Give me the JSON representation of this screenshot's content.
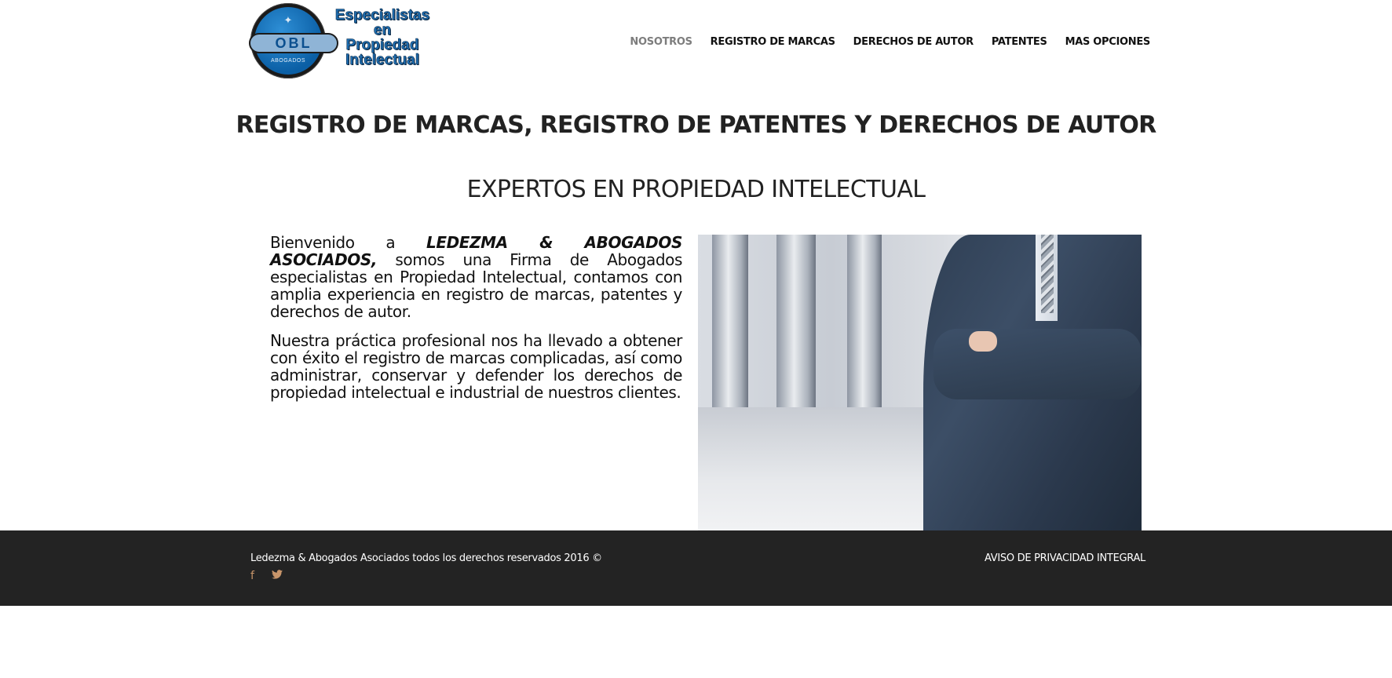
{
  "logo": {
    "badge_text": "OBL",
    "badge_sub": "ABOGADOS",
    "tagline_lines": [
      "Especialistas",
      "en",
      "Propiedad",
      "Intelectual"
    ]
  },
  "nav": {
    "items": [
      {
        "label": "NOSOTROS",
        "active": true
      },
      {
        "label": "REGISTRO DE MARCAS",
        "active": false
      },
      {
        "label": "DERECHOS DE AUTOR",
        "active": false
      },
      {
        "label": "PATENTES",
        "active": false
      },
      {
        "label": "MAS OPCIONES",
        "active": false
      }
    ]
  },
  "main": {
    "title": "REGISTRO DE MARCAS, REGISTRO DE PATENTES Y DERECHOS DE AUTOR",
    "subtitle": "EXPERTOS EN PROPIEDAD INTELECTUAL",
    "paragraph1_prefix": "Bienvenido a ",
    "paragraph1_bold": "LEDEZMA & ABOGADOS ASOCIADOS,",
    "paragraph1_rest": " somos una Firma de Abogados especialistas en Propiedad Intelectual, contamos con amplia experiencia en registro de marcas, patentes y derechos de autor.",
    "paragraph2": "Nuestra práctica profesional nos ha llevado a obtener con éxito el registro de marcas complicadas, así como administrar, conservar y defender los derechos de propiedad intelectual e industrial de nuestros clientes."
  },
  "footer": {
    "copyright": "Ledezma & Abogados Asociados todos los derechos reservados 2016 ©",
    "privacy_link": "AVISO DE PRIVACIDAD INTEGRAL",
    "social": [
      {
        "icon": "facebook-icon",
        "glyph": "f"
      },
      {
        "icon": "twitter-icon",
        "glyph": "🐦"
      }
    ]
  },
  "colors": {
    "nav_active": "#7d7d7d",
    "footer_bg": "#232323",
    "social_icons": "#c8956a",
    "logo_blue": "#1f6fb3"
  }
}
